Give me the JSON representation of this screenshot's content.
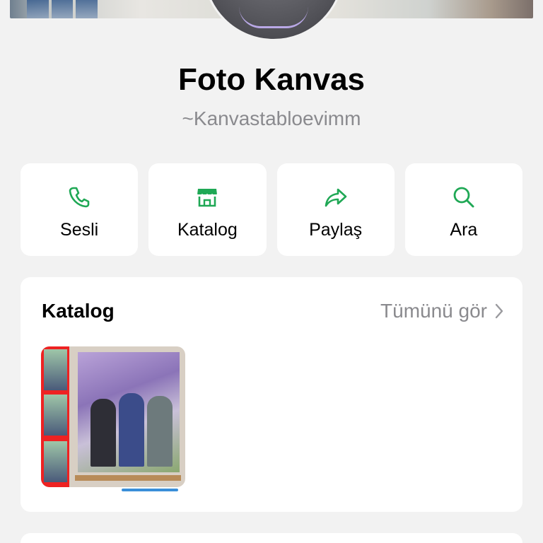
{
  "profile": {
    "name": "Foto Kanvas",
    "handle": "~Kanvastabloevimm"
  },
  "actions": [
    {
      "label": "Sesli",
      "icon": "phone-icon"
    },
    {
      "label": "Katalog",
      "icon": "storefront-icon"
    },
    {
      "label": "Paylaş",
      "icon": "share-arrow-icon"
    },
    {
      "label": "Ara",
      "icon": "search-icon"
    }
  ],
  "catalog": {
    "title": "Katalog",
    "see_all": "Tümünü gör",
    "items": [
      {
        "image": "canvas-photo-product"
      }
    ]
  },
  "colors": {
    "accent": "#1fa855",
    "background": "#f2f2f2",
    "card": "#ffffff",
    "muted": "#8a8a8e"
  }
}
